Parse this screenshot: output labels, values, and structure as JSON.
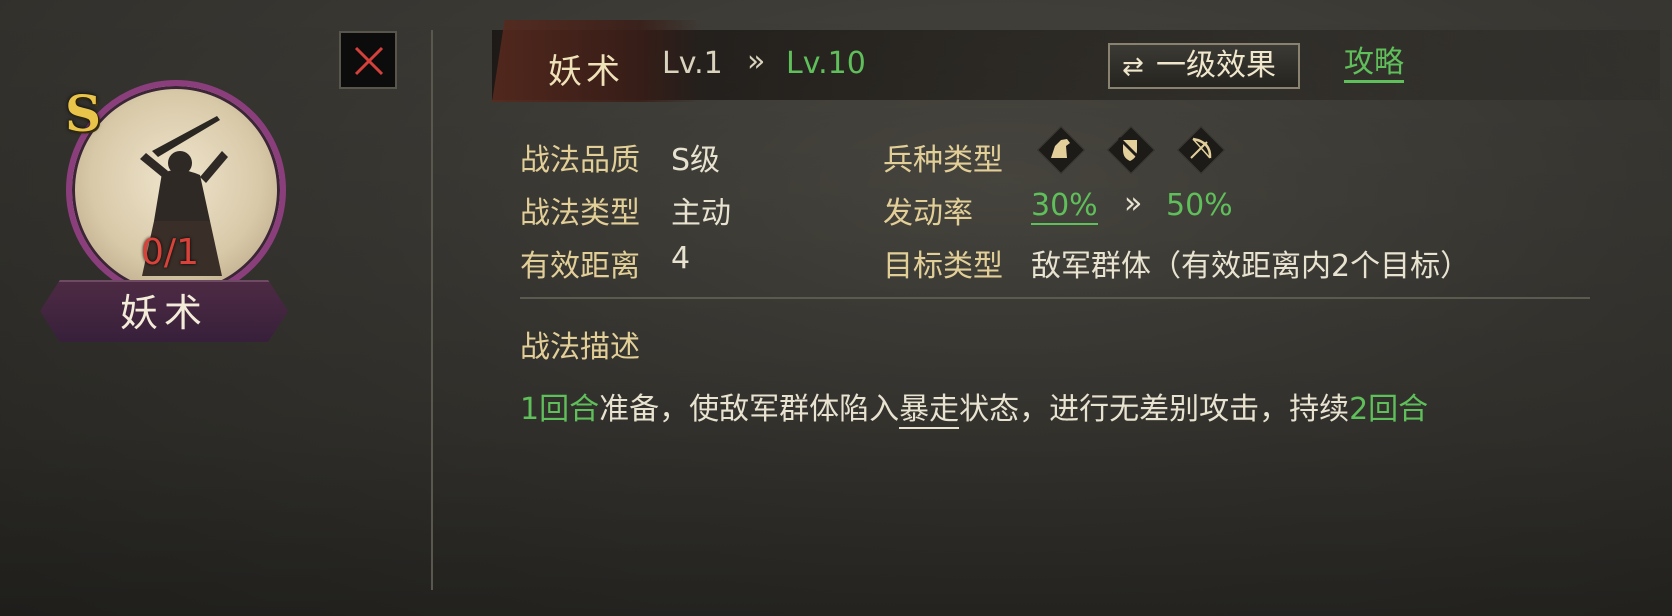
{
  "left_panel": {
    "grade": "S",
    "count": "0/1",
    "name": "妖术"
  },
  "header": {
    "skill_name": "妖术",
    "level_from": "Lv.1",
    "level_arrow": "»",
    "level_to": "Lv.10",
    "effect_button": "一级效果",
    "effect_icon": "swap-arrows-icon",
    "guide_link": "攻略"
  },
  "info": {
    "quality_label": "战法品质",
    "quality_value": "S级",
    "type_label": "战法类型",
    "type_value": "主动",
    "range_label": "有效距离",
    "range_value": "4",
    "troop_label": "兵种类型",
    "troop_icons": [
      "cavalry-icon",
      "shield-infantry-icon",
      "bow-archer-icon"
    ],
    "rate_label": "发动率",
    "rate_from": "30%",
    "rate_arrow": "»",
    "rate_to": "50%",
    "target_label": "目标类型",
    "target_value": "敌军群体（有效距离内2个目标）"
  },
  "description": {
    "title": "战法描述",
    "part1": "1回合",
    "part2": "准备，使敌军群体陷入",
    "part3": "暴走",
    "part4": "状态，进行无差别攻击，持续",
    "part5": "2回合"
  },
  "colors": {
    "accent_green": "#5fbf5a",
    "label_gold": "#e2cf98",
    "portrait_ring": "#8b3e7c",
    "count_red": "#d8423a"
  }
}
